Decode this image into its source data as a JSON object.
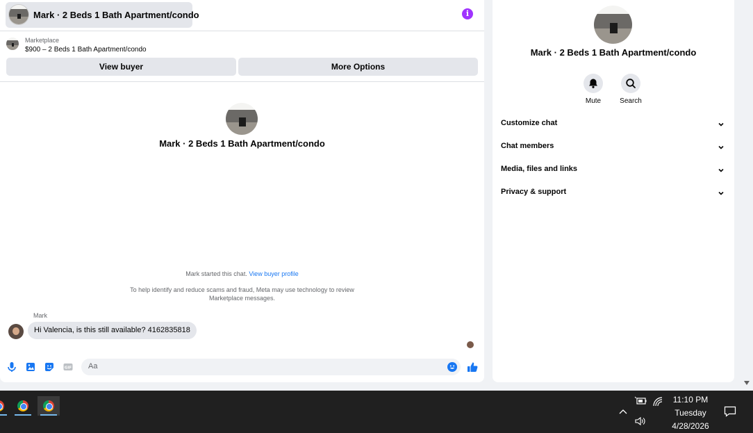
{
  "chat": {
    "title": "Mark · 2 Beds 1 Bath Apartment/condo",
    "info_icon": "info-icon",
    "listing": {
      "source": "Marketplace",
      "price_title": "$900 – 2 Beds 1 Bath Apartment/condo"
    },
    "buttons": {
      "view_buyer": "View buyer",
      "more_options": "More Options"
    },
    "center_title": "Mark · 2 Beds 1 Bath Apartment/condo",
    "started_text": "Mark started this chat.",
    "started_link": "View buyer profile",
    "disclaimer": "To help identify and reduce scams and fraud, Meta may use technology to review Marketplace messages.",
    "messages": [
      {
        "sender": "Mark",
        "text": "Hi Valencia, is this still available? 4162835818"
      }
    ],
    "composer": {
      "placeholder": "Aa",
      "icons": [
        "microphone-icon",
        "image-icon",
        "sticker-icon",
        "gif-icon",
        "emoji-icon",
        "thumbs-up-icon"
      ]
    }
  },
  "details": {
    "title": "Mark · 2 Beds 1 Bath Apartment/condo",
    "actions": [
      {
        "label": "Mute",
        "icon": "bell-icon"
      },
      {
        "label": "Search",
        "icon": "search-icon"
      }
    ],
    "menu": [
      {
        "label": "Customize chat"
      },
      {
        "label": "Chat members"
      },
      {
        "label": "Media, files and links"
      },
      {
        "label": "Privacy & support"
      }
    ]
  },
  "taskbar": {
    "time": "11:10 PM",
    "day": "Tuesday",
    "date": "4/28/2026"
  },
  "colors": {
    "accent_blue": "#1877f2",
    "info_purple": "#a033ff",
    "taskbar": "#202020"
  }
}
